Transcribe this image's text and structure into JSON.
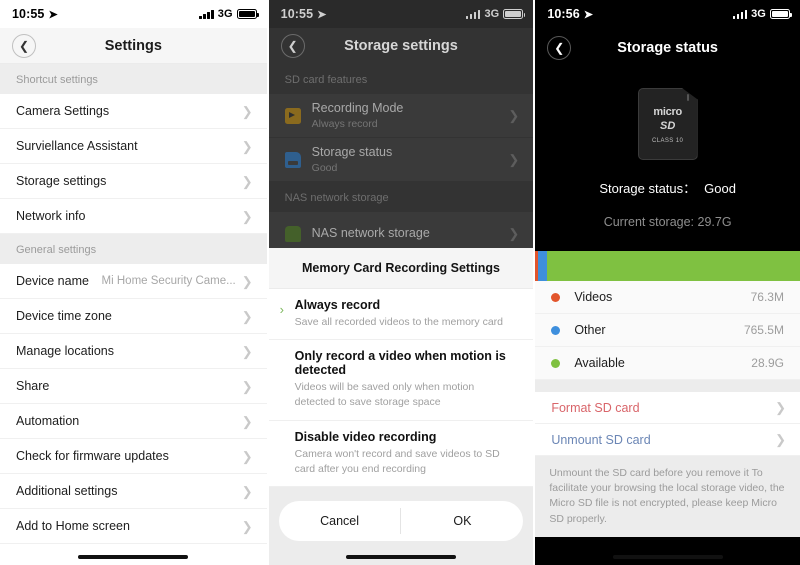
{
  "panels": {
    "settings": {
      "statusbar": {
        "time": "10:55",
        "network": "3G",
        "location_icon": "location-arrow-icon"
      },
      "nav": {
        "back_icon": "chevron-left-icon",
        "title": "Settings"
      },
      "sections": [
        {
          "header": "Shortcut settings",
          "rows": [
            {
              "label": "Camera Settings",
              "value": ""
            },
            {
              "label": "Surviellance Assistant",
              "value": ""
            },
            {
              "label": "Storage settings",
              "value": ""
            },
            {
              "label": "Network info",
              "value": ""
            }
          ]
        },
        {
          "header": "General settings",
          "rows": [
            {
              "label": "Device name",
              "value": "Mi Home Security Came..."
            },
            {
              "label": "Device time zone",
              "value": ""
            },
            {
              "label": "Manage locations",
              "value": ""
            },
            {
              "label": "Share",
              "value": ""
            },
            {
              "label": "Automation",
              "value": ""
            },
            {
              "label": "Check for firmware updates",
              "value": ""
            },
            {
              "label": "Additional settings",
              "value": ""
            },
            {
              "label": "Add to Home screen",
              "value": ""
            }
          ]
        }
      ]
    },
    "storage_settings": {
      "statusbar": {
        "time": "10:55",
        "network": "3G",
        "location_icon": "location-arrow-icon"
      },
      "nav": {
        "back_icon": "chevron-left-icon",
        "title": "Storage settings"
      },
      "sections": [
        {
          "header": "SD card features",
          "rows": [
            {
              "icon": "video-camera-icon",
              "title": "Recording Mode",
              "subtitle": "Always record"
            },
            {
              "icon": "sd-card-icon",
              "title": "Storage status",
              "subtitle": "Good"
            }
          ]
        },
        {
          "header": "NAS network storage",
          "rows": [
            {
              "icon": "nas-drive-icon",
              "title": "NAS network storage",
              "subtitle": ""
            }
          ]
        }
      ],
      "modal": {
        "title": "Memory Card Recording Settings",
        "options": [
          {
            "title": "Always record",
            "description": "Save all recorded videos to the memory card",
            "selected": true
          },
          {
            "title": "Only record a video when motion is detected",
            "description": "Videos will be saved only when motion detected to save storage space",
            "selected": false
          },
          {
            "title": "Disable video recording",
            "description": "Camera won't record and save videos to SD card after you end recording",
            "selected": false
          }
        ],
        "cancel_label": "Cancel",
        "ok_label": "OK"
      }
    },
    "storage_status": {
      "statusbar": {
        "time": "10:56",
        "network": "3G",
        "location_icon": "location-arrow-icon"
      },
      "nav": {
        "back_icon": "chevron-left-icon",
        "title": "Storage status"
      },
      "card_art": {
        "micro": "micro",
        "sd": "SD",
        "class": "CLASS 10"
      },
      "status_label": "Storage status：",
      "status_value": "Good",
      "current_storage": "Current storage: 29.7G",
      "legend": [
        {
          "name": "Videos",
          "value": "76.3M",
          "color": "#e2552c"
        },
        {
          "name": "Other",
          "value": "765.5M",
          "color": "#3e8fdd"
        },
        {
          "name": "Available",
          "value": "28.9G",
          "color": "#7fc141"
        }
      ],
      "actions": [
        {
          "label": "Format SD card",
          "color": "#d9656a"
        },
        {
          "label": "Unmount SD card",
          "color": "#6b86b5"
        }
      ],
      "note": "Unmount the SD card before you remove it\nTo facilitate your browsing the local storage video, the Micro SD file is not encrypted, please keep Micro SD properly."
    }
  },
  "chart_data": {
    "type": "bar",
    "title": "SD card storage usage",
    "categories": [
      "Videos",
      "Other",
      "Available"
    ],
    "values": [
      0.0763,
      0.7655,
      28.9
    ],
    "value_labels": [
      "76.3M",
      "765.5M",
      "28.9G"
    ],
    "colors": [
      "#e2552c",
      "#3e8fdd",
      "#7fc141"
    ],
    "total": "29.7G",
    "unit": "GB",
    "orientation": "horizontal-stacked",
    "legend_position": "below"
  }
}
